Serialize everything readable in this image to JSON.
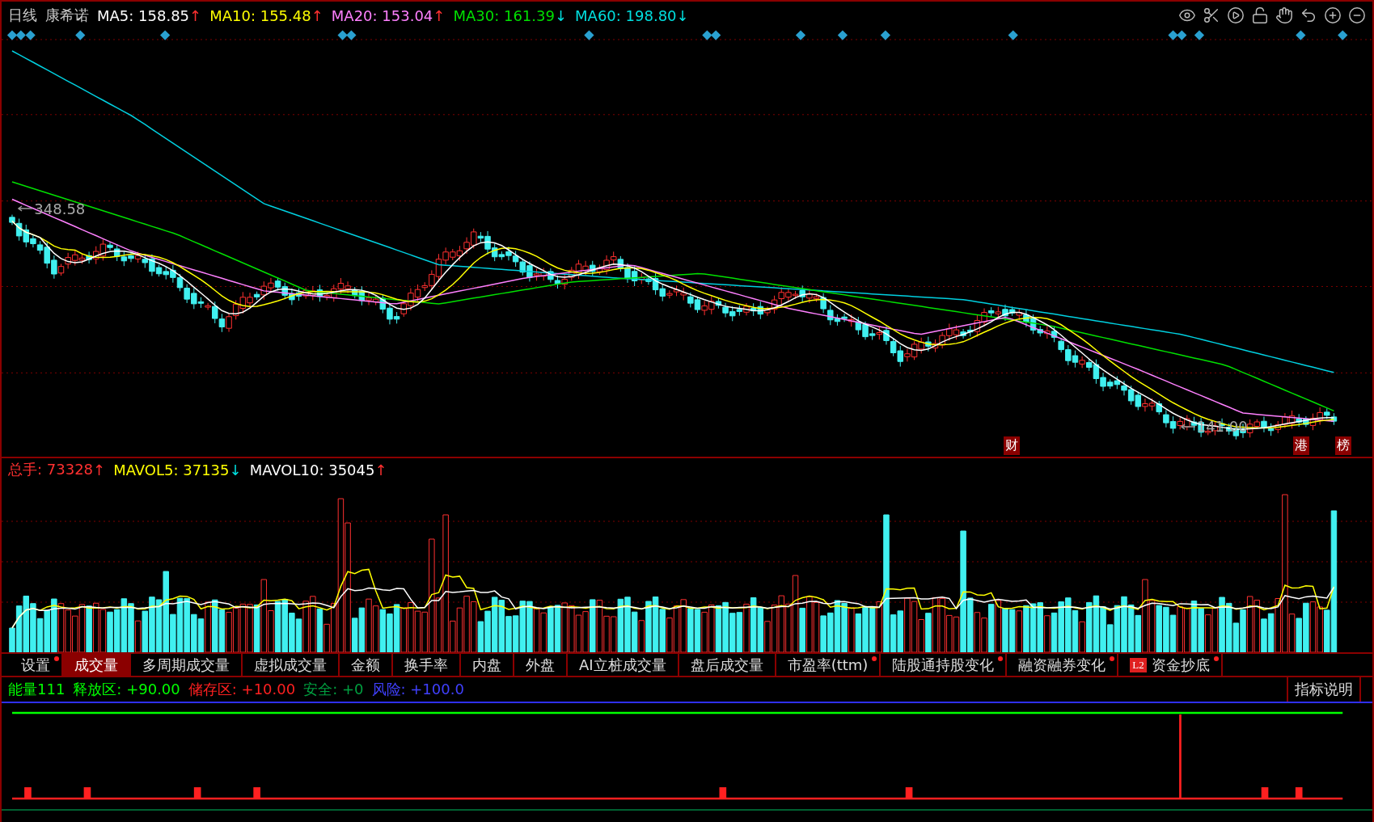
{
  "header": {
    "period": "日线",
    "stock": "康希诺",
    "legend": [
      {
        "label": "MA5: 158.85",
        "color": "#ffffff",
        "arrow": {
          "text": "↑",
          "color": "#ff3030"
        }
      },
      {
        "label": "MA10: 155.48",
        "color": "#ffff00",
        "arrow": {
          "text": "↑",
          "color": "#ff3030"
        }
      },
      {
        "label": "MA20: 153.04",
        "color": "#ff80ff",
        "arrow": {
          "text": "↑",
          "color": "#ff3030"
        }
      },
      {
        "label": "MA30: 161.39",
        "color": "#00e000",
        "arrow": {
          "text": "↓",
          "color": "#00e0e0"
        }
      },
      {
        "label": "MA60: 198.80",
        "color": "#00e0e0",
        "arrow": {
          "text": "↓",
          "color": "#00e0e0"
        }
      }
    ]
  },
  "price_chart": {
    "high_label": "348.58",
    "low_label": "141.00",
    "events": [
      {
        "text": "财"
      },
      {
        "text": "港"
      },
      {
        "text": "榜"
      }
    ]
  },
  "volume_header": {
    "legend": [
      {
        "label": "总手: 73328",
        "color": "#ff3030",
        "arrow": {
          "text": "↑",
          "color": "#ff3030"
        }
      },
      {
        "label": "MAVOL5: 37135",
        "color": "#ffff00",
        "arrow": {
          "text": "↓",
          "color": "#00e0e0"
        }
      },
      {
        "label": "MAVOL10: 35045",
        "color": "#ffffff",
        "arrow": {
          "text": "↑",
          "color": "#ff3030"
        }
      }
    ]
  },
  "tabs": [
    {
      "label": "设置",
      "selected": false,
      "dot": true
    },
    {
      "label": "成交量",
      "selected": true,
      "dot": false
    },
    {
      "label": "多周期成交量",
      "selected": false,
      "dot": false
    },
    {
      "label": "虚拟成交量",
      "selected": false,
      "dot": false
    },
    {
      "label": "金额",
      "selected": false,
      "dot": false
    },
    {
      "label": "换手率",
      "selected": false,
      "dot": false
    },
    {
      "label": "内盘",
      "selected": false,
      "dot": false
    },
    {
      "label": "外盘",
      "selected": false,
      "dot": false
    },
    {
      "label": "AI立桩成交量",
      "selected": false,
      "dot": false
    },
    {
      "label": "盘后成交量",
      "selected": false,
      "dot": false
    },
    {
      "label": "市盈率(ttm)",
      "selected": false,
      "dot": true
    },
    {
      "label": "陆股通持股变化",
      "selected": false,
      "dot": true
    },
    {
      "label": "融资融券变化",
      "selected": false,
      "dot": true
    },
    {
      "label": "资金抄底",
      "selected": false,
      "dot": true,
      "badge": "L2"
    }
  ],
  "indicator": {
    "legend": [
      {
        "label": "能量111",
        "color": "#00ff00"
      },
      {
        "label": "释放区: +90.00",
        "color": "#00ff00"
      },
      {
        "label": "储存区: +10.00",
        "color": "#ff2020"
      },
      {
        "label": "安全: +0",
        "color": "#00a040"
      },
      {
        "label": "风险: +100.0",
        "color": "#4040ff"
      }
    ],
    "help_button": "指标说明"
  }
}
